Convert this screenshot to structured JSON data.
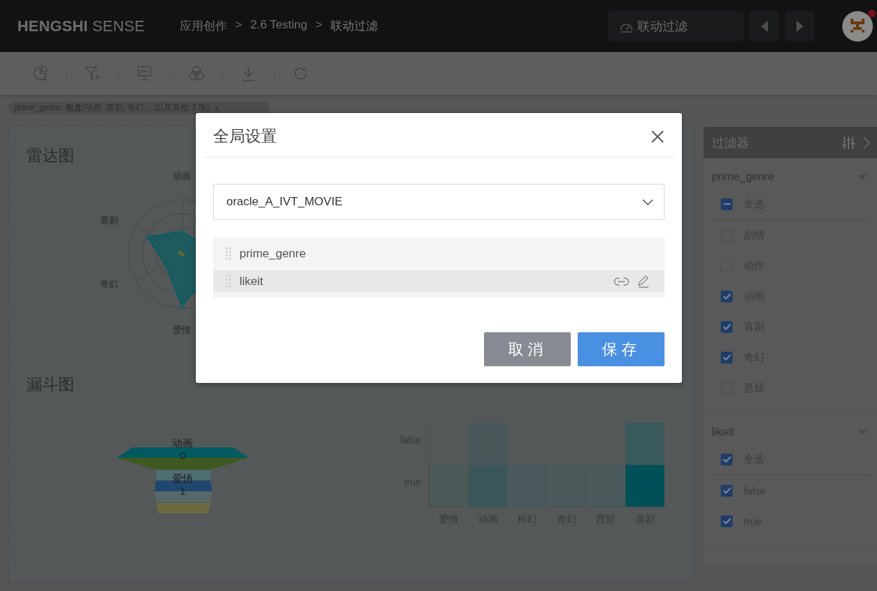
{
  "header": {
    "logo": "**HENGSHI** SENSE",
    "breadcrumb": [
      {
        "kind": "link",
        "text": "应用创作"
      },
      {
        "kind": "separator",
        "text": ">"
      },
      {
        "kind": "link",
        "text": "2.6 Testing"
      },
      {
        "kind": "separator",
        "text": ">"
      },
      {
        "kind": "current",
        "text": "联动过滤"
      }
    ],
    "dashboard_button": "联动过滤",
    "avatar": {
      "notification": true
    }
  },
  "filter_chip": {
    "text": "prime_genre: **包含**(动画, 喜剧, 奇幻, ...以及其他 3 项)",
    "close": "x"
  },
  "radar": {
    "title": "雷达图",
    "axis_labels": [
      "动画",
      "喜剧",
      "奇幻",
      "爱情"
    ]
  },
  "funnel": {
    "title": "漏斗图",
    "segments": [
      {
        "color": "#005a60"
      },
      {
        "color": "#3f5a20"
      },
      {
        "color": "#4e6e74"
      },
      {
        "color": "#1e4870"
      },
      {
        "color": "#56686a"
      },
      {
        "color": "#6e6a40"
      }
    ],
    "labels": [
      {
        "name": "动画",
        "value": "0"
      },
      {
        "name": "爱情",
        "value": "1"
      }
    ]
  },
  "heatmap": {
    "x_labels": [
      "爱情",
      "动画",
      "科幻",
      "奇幻",
      "西部",
      "喜剧"
    ],
    "rows": [
      {
        "label": "false"
      },
      {
        "label": "true"
      }
    ]
  },
  "filter_panel": {
    "title": "过滤器",
    "groups": [
      {
        "field": "prime_genre",
        "select_all": {
          "label": "全选",
          "partial": true
        },
        "options": [
          {
            "label": "剧情",
            "checked": false
          },
          {
            "label": "动作",
            "checked": false
          },
          {
            "label": "动画",
            "checked": true
          },
          {
            "label": "喜剧",
            "checked": true
          },
          {
            "label": "奇幻",
            "checked": true
          },
          {
            "label": "悬疑",
            "checked": false
          }
        ]
      },
      {
        "field": "likeit",
        "select_all": {
          "label": "全选",
          "checked": true
        },
        "options": [
          {
            "label": "false",
            "checked": true
          },
          {
            "label": "true",
            "checked": true
          }
        ]
      }
    ]
  },
  "dialog": {
    "title": "全局设置",
    "dataset": "oracle_A_IVT_MOVIE",
    "fields": [
      {
        "name": "prime_genre",
        "selected": false
      },
      {
        "name": "likeit",
        "selected": true
      }
    ],
    "buttons": [
      {
        "kind": "cancel",
        "label": "取消"
      },
      {
        "kind": "save",
        "label": "保存"
      }
    ]
  }
}
